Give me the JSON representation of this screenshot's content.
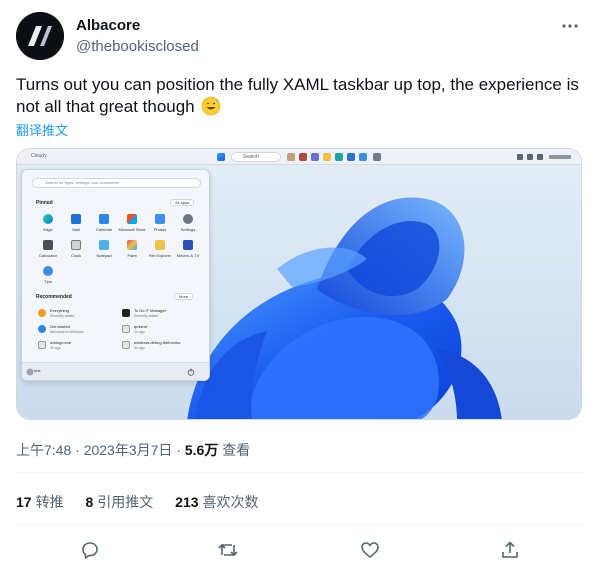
{
  "author": {
    "name": "Albacore",
    "handle": "@thebookisclosed",
    "avatar_icon": "albacore-logo-icon"
  },
  "tweet": {
    "text": "Turns out you can position the fully XAML taskbar up top, the experience is not all that great though",
    "emoji": "grinning-sweat-emoji",
    "translate_label": "翻译推文"
  },
  "media": {
    "taskbar": {
      "left_text": "Cloudy",
      "search_label": "Search"
    },
    "start_menu": {
      "search_placeholder": "Search for apps, settings, and documents",
      "pinned_label": "Pinned",
      "all_apps_label": "All apps",
      "recommended_label": "Recommended",
      "more_label": "More",
      "user_label": "test",
      "apps": [
        "Edge",
        "Mail",
        "Calendar",
        "Microsoft Store",
        "Photos",
        "Settings",
        "Calculator",
        "Clock",
        "Notepad",
        "Paint",
        "File Explorer",
        "Movies & TV",
        "Tips"
      ],
      "recommended": [
        {
          "title": "Everything",
          "sub": "Recently added"
        },
        {
          "title": "To Do IT Manager",
          "sub": "Recently added"
        },
        {
          "title": "Get started",
          "sub": "Welcome to Windows"
        },
        {
          "title": "qmlsmt",
          "sub": "3h ago"
        },
        {
          "title": "winlogo.exe",
          "sub": "3h ago"
        },
        {
          "title": "windows.debug.firefoxxlsx",
          "sub": "3h ago"
        }
      ]
    },
    "colors": {
      "wallpaper_bg": "#d9e7f3",
      "bloom_dark": "#0a3fd6",
      "bloom_light": "#4f9cff",
      "taskbar": "#eef1f6"
    }
  },
  "meta": {
    "time": "上午7:48",
    "separator": "·",
    "date": "2023年3月7日",
    "views_count": "5.6万",
    "views_label": "查看"
  },
  "stats": {
    "retweets_count": "17",
    "retweets_label": "转推",
    "quotes_count": "8",
    "quotes_label": "引用推文",
    "likes_count": "213",
    "likes_label": "喜欢次数"
  },
  "actions": [
    "reply-icon",
    "retweet-icon",
    "like-icon",
    "share-icon"
  ]
}
